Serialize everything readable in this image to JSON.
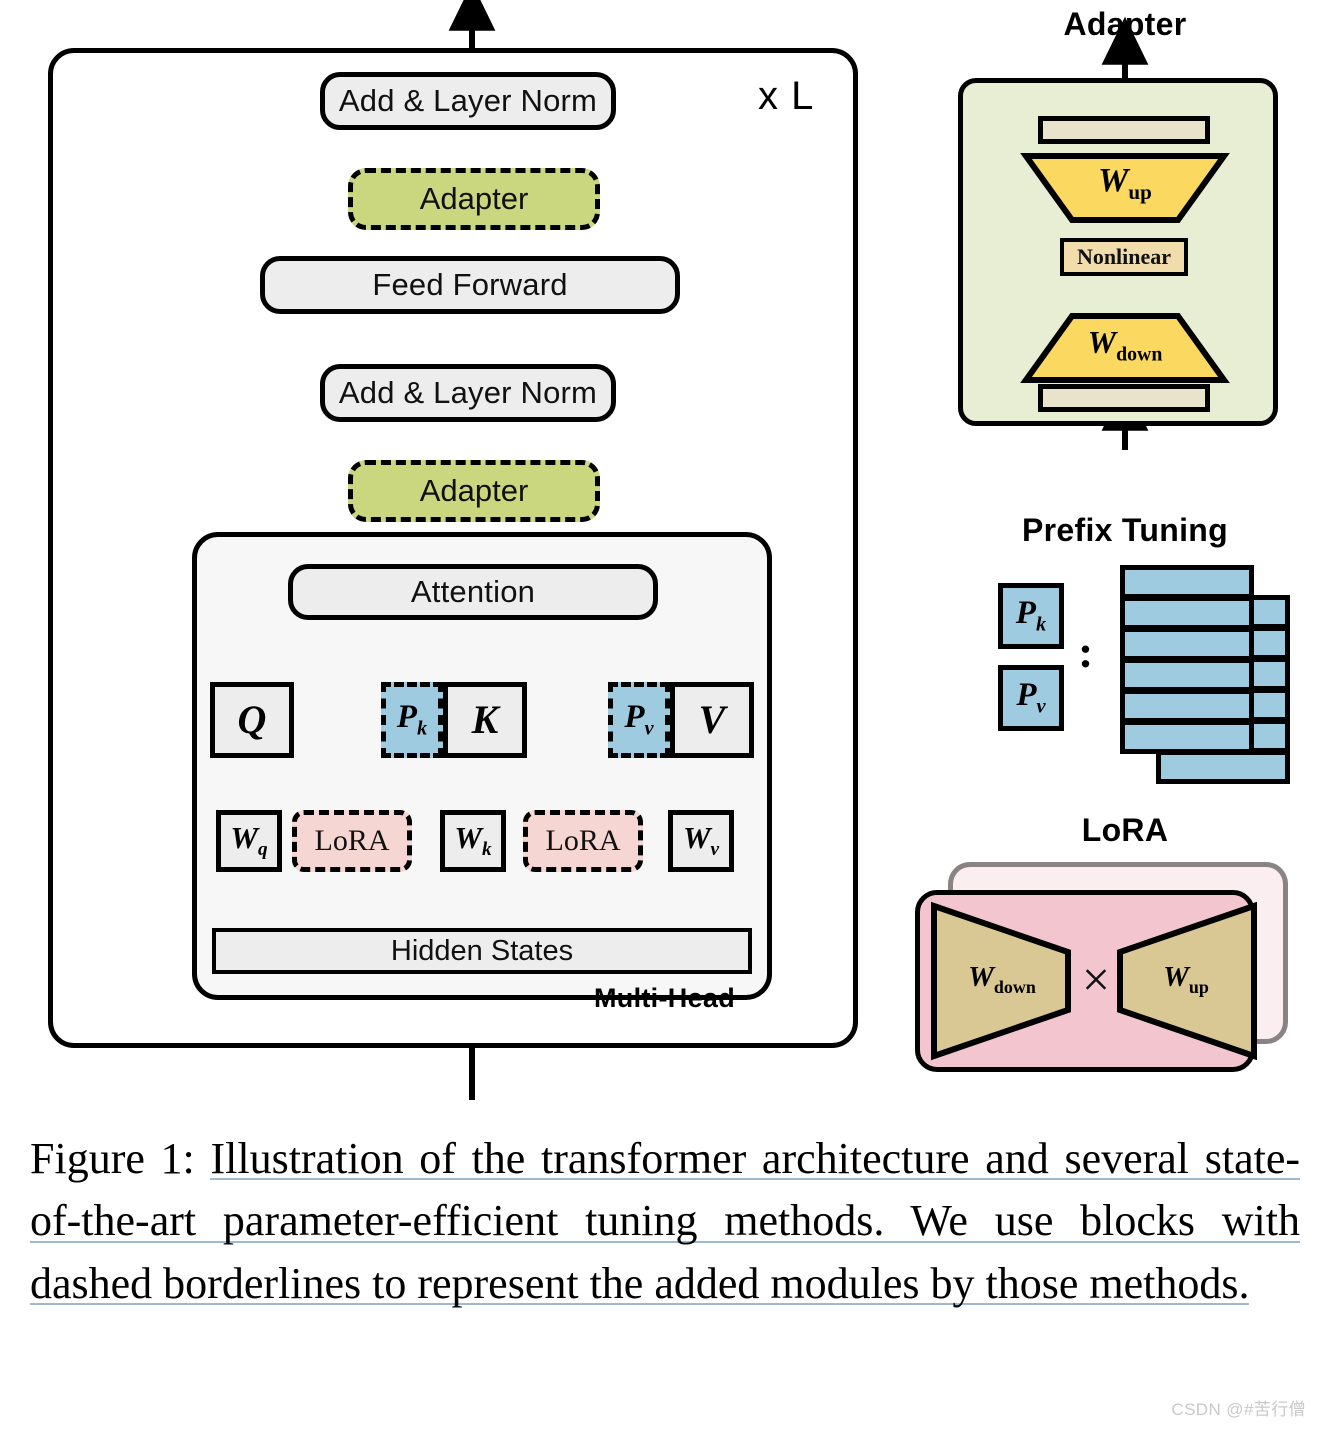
{
  "figure": {
    "main_diagram": {
      "repeat_label": "x L",
      "blocks": [
        {
          "id": "add_norm_top",
          "label": "Add & Layer Norm",
          "style": "grey-rounded"
        },
        {
          "id": "adapter_ffn",
          "label": "Adapter",
          "style": "green-dashed"
        },
        {
          "id": "feed_forward",
          "label": "Feed Forward",
          "style": "grey-rounded"
        },
        {
          "id": "add_norm_bottom",
          "label": "Add & Layer Norm",
          "style": "grey-rounded"
        },
        {
          "id": "adapter_attn",
          "label": "Adapter",
          "style": "green-dashed"
        },
        {
          "id": "attention",
          "label": "Attention",
          "style": "grey-rounded"
        },
        {
          "id": "hidden_states",
          "label": "Hidden States",
          "style": "grey-rect"
        }
      ],
      "multi_head_label": "Multi-Head",
      "projection_boxes": [
        {
          "id": "q",
          "label": "Q",
          "sub": ""
        },
        {
          "id": "k",
          "label": "K",
          "sub": ""
        },
        {
          "id": "v",
          "label": "V",
          "sub": ""
        }
      ],
      "prefix_boxes": [
        {
          "id": "pk",
          "label": "P",
          "sub": "k"
        },
        {
          "id": "pv",
          "label": "P",
          "sub": "v"
        }
      ],
      "weight_boxes": [
        {
          "id": "wq",
          "label": "W",
          "sub": "q"
        },
        {
          "id": "wk",
          "label": "W",
          "sub": "k"
        },
        {
          "id": "wv",
          "label": "W",
          "sub": "v"
        }
      ],
      "lora_boxes": [
        {
          "id": "lora_q",
          "label": "LoRA"
        },
        {
          "id": "lora_k",
          "label": "LoRA"
        }
      ],
      "add_operator": "⊕"
    },
    "adapter_panel": {
      "title": "Adapter",
      "up_label": "W",
      "up_sub": "up",
      "nonlinear_label": "Nonlinear",
      "down_label": "W",
      "down_sub": "down",
      "add_operator": "⊕"
    },
    "prefix_panel": {
      "title": "Prefix Tuning",
      "pk_label": "P",
      "pk_sub": "k",
      "pv_label": "P",
      "pv_sub": "v",
      "separator": ":",
      "front_rows": 6,
      "back_rows": 6
    },
    "lora_panel": {
      "title": "LoRA",
      "down_label": "W",
      "down_sub": "down",
      "operator": "×",
      "up_label": "W",
      "up_sub": "up"
    },
    "colors": {
      "adapter_green": "#cbd77e",
      "adapter_panel_bg": "#e7eed4",
      "beige": "#eae3cc",
      "yellow_trapezoid": "#fbd860",
      "nonlinear_tan": "#f0ddab",
      "prefix_blue": "#9fcbe0",
      "lora_pink_front": "#f3c6cf",
      "lora_pink_back": "#fbeef0",
      "lora_tan_trapezoid": "#d9c894",
      "lora_box_pink": "#f6d6d3",
      "block_grey": "#ededed",
      "multihead_bg": "#f7f7f7",
      "arrow_red": "#9e2b35",
      "caption_underline": "#9fb9cf"
    }
  },
  "caption": {
    "prefix": "Figure 1:",
    "text": "Illustration of the transformer architecture and several state-of-the-art parameter-efficient tuning methods. We use blocks with dashed borderlines to represent the added modules by those methods."
  },
  "watermark": {
    "text": "CSDN @#苦行僧"
  }
}
